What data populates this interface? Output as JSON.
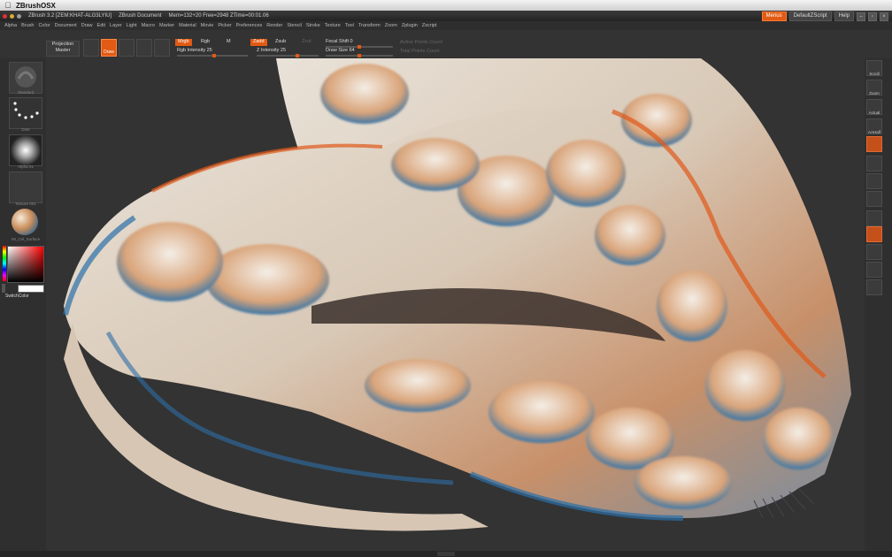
{
  "os_menu": {
    "app_name": "ZBrushOSX"
  },
  "titlebar": {
    "app_title": "ZBrush 3.2 [ZEM:KHAT-ALG3LYIU]",
    "doc_title": "ZBrush Document",
    "stats": "Mem=132+20 Free=2948 ZTime=00:01.06",
    "menus_button": "Menus",
    "script_button": "DefaultZScript",
    "help_button": "Help"
  },
  "palette_menu": [
    "Alpha",
    "Brush",
    "Color",
    "Document",
    "Draw",
    "Edit",
    "Layer",
    "Light",
    "Macro",
    "Marker",
    "Material",
    "Movie",
    "Picker",
    "Preferences",
    "Render",
    "Stencil",
    "Stroke",
    "Texture",
    "Tool",
    "Transform",
    "Zoom",
    "Zplugin",
    "Zscript"
  ],
  "shelf": {
    "projection_label": "Projection",
    "master_label": "Master",
    "draw_label": "Draw",
    "mrgb": "Mrgb",
    "rgb": "Rgb",
    "m": "M",
    "zadd": "Zadd",
    "zsub": "Zsub",
    "zcut": "Zcut",
    "rgb_intensity": "Rgb Intensity 25",
    "z_intensity": "Z Intensity 25",
    "focal_shift": "Focal Shift 0",
    "draw_size": "Draw Size 64",
    "active_points": "Active Points Count",
    "total_points": "Total Points Count"
  },
  "left_tray": {
    "brush_label": "Standard",
    "stroke_label": "Dots",
    "alpha_label": "Alpha 01",
    "texture_label": "Texture 001",
    "material_label": "MI_Cel_Surface",
    "switch_color": "SwitchColor"
  },
  "right_tray": [
    "Scroll",
    "Zoom",
    "Actual",
    "AAHalf",
    "",
    "",
    "",
    "",
    "",
    "",
    "",
    "",
    ""
  ],
  "colors": {
    "accent": "#e25a13",
    "panel": "#2f2f2f",
    "canvas": "#333333"
  },
  "scene": {
    "subject": "sculpted creature skull rendered in anaglyph-style orange and blue"
  }
}
